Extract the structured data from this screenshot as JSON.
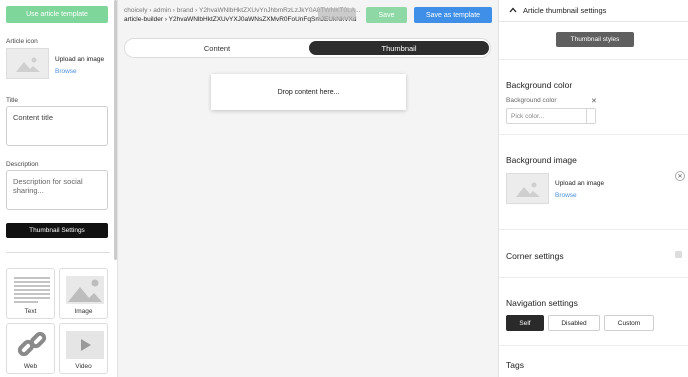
{
  "left_panel": {
    "use_template_label": "Use article template",
    "article_icon_label": "Article icon",
    "upload_label": "Upload an image",
    "browse_label": "Browse",
    "title_label": "Title",
    "title_value": "Content title",
    "description_label": "Description",
    "description_placeholder": "Description for social sharing...",
    "thumbnail_settings_label": "Thumbnail Settings",
    "tiles": [
      {
        "label": "Text",
        "icon": "text-lines-icon"
      },
      {
        "label": "Image",
        "icon": "image-icon"
      },
      {
        "label": "Web",
        "icon": "link-icon"
      },
      {
        "label": "Video",
        "icon": "play-icon"
      }
    ]
  },
  "header": {
    "breadcrumb": "choicely › admin › brand › Y2hvaWNlbHktZXUvYnJhbmRzLzJkY0A0TWNKT0LA...",
    "path": "article-builder › Y2hvaWNlbHktZXUvYXJ0aWNsZXMvR0FoUnFqSmJEUkNkVXd",
    "save_label": "Save",
    "save_template_label": "Save as template"
  },
  "editor": {
    "tabs": [
      {
        "label": "Content",
        "active": false
      },
      {
        "label": "Thumbnail",
        "active": true
      }
    ],
    "drop_text": "Drop content here..."
  },
  "right_panel": {
    "header_title": "Article thumbnail settings",
    "thumbnail_styles_label": "Thumbnail styles",
    "background_color": {
      "title": "Background color",
      "field_label": "Background color",
      "placeholder": "Pick color..."
    },
    "background_image": {
      "title": "Background image",
      "upload_label": "Upload an image",
      "browse_label": "Browse"
    },
    "corner_settings_title": "Corner settings",
    "navigation": {
      "title": "Navigation settings",
      "options": [
        {
          "label": "Self",
          "active": true
        },
        {
          "label": "Disabled",
          "active": false
        },
        {
          "label": "Custom",
          "active": false
        }
      ]
    },
    "tags_title": "Tags"
  },
  "colors": {
    "green": "#7fd69b",
    "blue": "#3f8fe8",
    "dark": "#2d2d2d"
  }
}
